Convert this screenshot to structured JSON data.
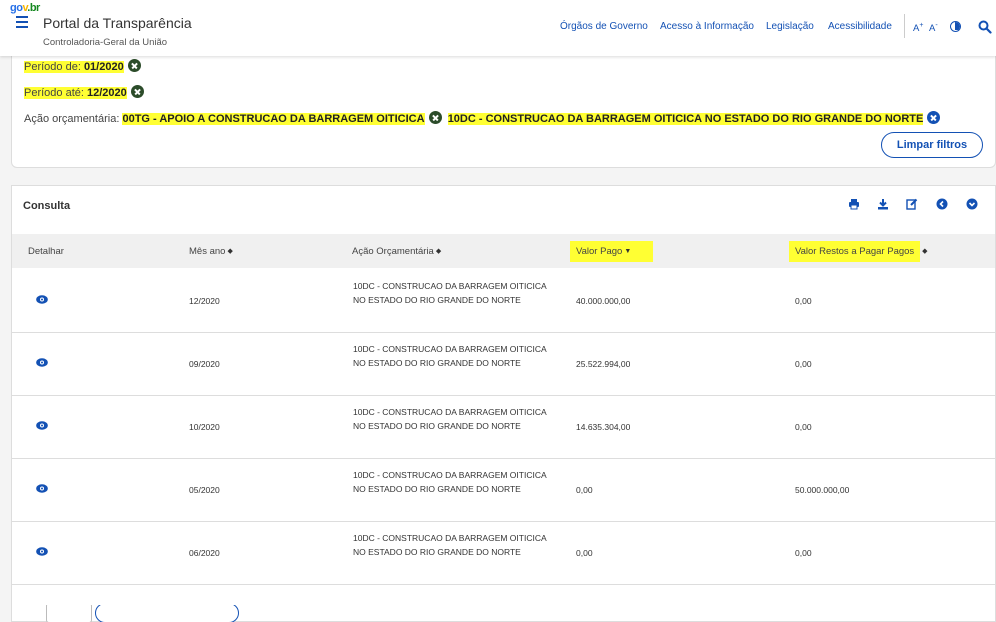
{
  "header": {
    "logo": {
      "g": "go",
      "v": "v",
      "br": ".br"
    },
    "title": "Portal da Transparência",
    "subtitle": "Controladoria-Geral da União",
    "nav": [
      "Órgãos de Governo",
      "Acesso à Informação",
      "Legislação",
      "Acessibilidade"
    ],
    "font_increase": "A",
    "font_increase_sign": "+",
    "font_decrease": "A",
    "font_decrease_sign": "-"
  },
  "filters": {
    "periodo_de_label": "Período de:",
    "periodo_de_value": "01/2020",
    "periodo_ate_label": "Período até:",
    "periodo_ate_value": "12/2020",
    "acao_label": "Ação orçamentária:",
    "acao_value_1": "00TG - APOIO A CONSTRUCAO DA BARRAGEM OITICICA",
    "acao_value_2": "10DC - CONSTRUCAO DA BARRAGEM OITICICA NO ESTADO DO RIO GRANDE DO NORTE",
    "clear_button": "Limpar filtros"
  },
  "consulta": {
    "title": "Consulta",
    "tools": [
      "print-icon",
      "download-icon",
      "edit-icon",
      "back-icon",
      "expand-icon"
    ],
    "columns": {
      "detalhar": "Detalhar",
      "mes_ano": "Mês ano",
      "acao": "Ação Orçamentária",
      "valor_pago": "Valor Pago",
      "restos": "Valor Restos a Pagar Pagos"
    },
    "rows": [
      {
        "mes": "12/2020",
        "acao": "10DC - CONSTRUCAO DA BARRAGEM OITICICA NO ESTADO DO RIO GRANDE DO NORTE",
        "pago": "40.000.000,00",
        "restos": "0,00"
      },
      {
        "mes": "09/2020",
        "acao": "10DC - CONSTRUCAO DA BARRAGEM OITICICA NO ESTADO DO RIO GRANDE DO NORTE",
        "pago": "25.522.994,00",
        "restos": "0,00"
      },
      {
        "mes": "10/2020",
        "acao": "10DC - CONSTRUCAO DA BARRAGEM OITICICA NO ESTADO DO RIO GRANDE DO NORTE",
        "pago": "14.635.304,00",
        "restos": "0,00"
      },
      {
        "mes": "05/2020",
        "acao": "10DC - CONSTRUCAO DA BARRAGEM OITICICA NO ESTADO DO RIO GRANDE DO NORTE",
        "pago": "0,00",
        "restos": "50.000.000,00"
      },
      {
        "mes": "06/2020",
        "acao": "10DC - CONSTRUCAO DA BARRAGEM OITICICA NO ESTADO DO RIO GRANDE DO NORTE",
        "pago": "0,00",
        "restos": "0,00"
      }
    ]
  },
  "colors": {
    "primary": "#1351b4",
    "highlight": "#ffff33",
    "filter_icon": "#2c4c2a"
  }
}
